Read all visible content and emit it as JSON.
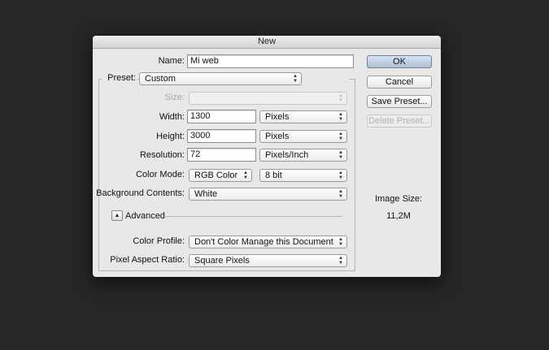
{
  "dialog": {
    "title": "New"
  },
  "fields": {
    "name_label": "Name:",
    "name_value": "Mi web",
    "preset_label": "Preset:",
    "preset_value": "Custom",
    "size_label": "Size:",
    "size_value": "",
    "width_label": "Width:",
    "width_value": "1300",
    "width_unit": "Pixels",
    "height_label": "Height:",
    "height_value": "3000",
    "height_unit": "Pixels",
    "resolution_label": "Resolution:",
    "resolution_value": "72",
    "resolution_unit": "Pixels/Inch",
    "color_mode_label": "Color Mode:",
    "color_mode_value": "RGB Color",
    "bit_depth_value": "8 bit",
    "background_label": "Background Contents:",
    "background_value": "White",
    "advanced_label": "Advanced",
    "color_profile_label": "Color Profile:",
    "color_profile_value": "Don't Color Manage this Document",
    "pixel_aspect_label": "Pixel Aspect Ratio:",
    "pixel_aspect_value": "Square Pixels"
  },
  "buttons": {
    "ok": "OK",
    "cancel": "Cancel",
    "save_preset": "Save Preset...",
    "delete_preset": "Delete Preset..."
  },
  "image_size": {
    "label": "Image Size:",
    "value": "11,2M"
  },
  "icons": {
    "popup_arrows": "up-down-arrows-icon",
    "disclosure": "triangle-up-icon"
  },
  "colors": {
    "desktop": "#262626",
    "dialog": "#e8e8e8",
    "ok_button": "#b8c9dc"
  }
}
